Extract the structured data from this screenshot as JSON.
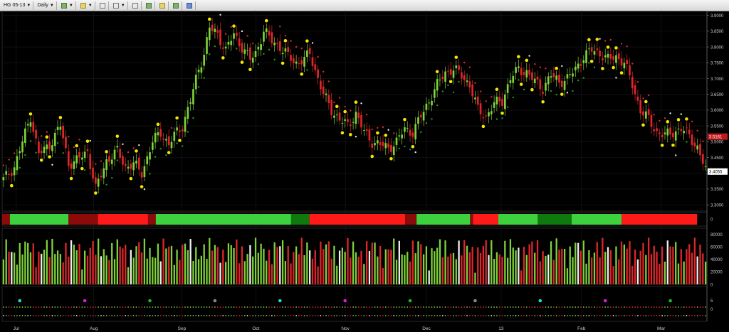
{
  "toolbar": {
    "instrument": "HG 05-13",
    "interval": "Daily"
  },
  "colors": {
    "up": "#7fd23a",
    "down": "#e0262a",
    "background": "#000000",
    "sar_up": "#1aa01a",
    "sar_down": "#e0262a",
    "sar_neutral": "#e8e8e8",
    "swing": "#f2e600",
    "band_strong_green": "#3dd13d",
    "band_dark_green": "#0e7a0e",
    "band_red": "#ff1a1a",
    "band_dark_red": "#8c0a0a"
  },
  "chart_data": {
    "type": "candlestick",
    "instrument": "HG 05-13",
    "interval": "Daily",
    "x_tick_labels": [
      "Jul",
      "Aug",
      "Sep",
      "Oct",
      "Nov",
      "Dec",
      "13",
      "Feb",
      "Mar"
    ],
    "price_axis": {
      "ticks": [
        "3.9000",
        "3.8500",
        "3.8000",
        "3.7500",
        "3.7000",
        "3.6500",
        "3.6000",
        "3.5500",
        "3.5000",
        "3.4500",
        "3.4000",
        "3.3500",
        "3.3000"
      ],
      "range": [
        3.28,
        3.915
      ]
    },
    "price_labels": {
      "marker_1": "3.5161",
      "marker_2": "3.4055"
    },
    "volume_axis": {
      "ticks": [
        "80000",
        "60000",
        "40000",
        "20000",
        "0"
      ],
      "range": [
        0,
        90000
      ]
    },
    "band_axis": {
      "ticks": [
        "0"
      ]
    },
    "dots_axis": {
      "ticks": [
        "5",
        "0"
      ]
    },
    "trend_band": [
      {
        "from": 0.0,
        "to": 0.011,
        "state": "dark_red"
      },
      {
        "from": 0.011,
        "to": 0.094,
        "state": "strong_green"
      },
      {
        "from": 0.094,
        "to": 0.136,
        "state": "dark_red"
      },
      {
        "from": 0.136,
        "to": 0.207,
        "state": "red"
      },
      {
        "from": 0.207,
        "to": 0.218,
        "state": "dark_red"
      },
      {
        "from": 0.218,
        "to": 0.41,
        "state": "strong_green"
      },
      {
        "from": 0.41,
        "to": 0.436,
        "state": "dark_green"
      },
      {
        "from": 0.436,
        "to": 0.572,
        "state": "red"
      },
      {
        "from": 0.572,
        "to": 0.588,
        "state": "dark_red"
      },
      {
        "from": 0.588,
        "to": 0.664,
        "state": "strong_green"
      },
      {
        "from": 0.664,
        "to": 0.668,
        "state": "dark_red"
      },
      {
        "from": 0.668,
        "to": 0.704,
        "state": "red"
      },
      {
        "from": 0.704,
        "to": 0.76,
        "state": "strong_green"
      },
      {
        "from": 0.76,
        "to": 0.808,
        "state": "dark_green"
      },
      {
        "from": 0.808,
        "to": 0.879,
        "state": "strong_green"
      },
      {
        "from": 0.879,
        "to": 0.986,
        "state": "red"
      }
    ],
    "anchors": [
      [
        0,
        3.38
      ],
      [
        4,
        3.42
      ],
      [
        7,
        3.5
      ],
      [
        10,
        3.58
      ],
      [
        13,
        3.46
      ],
      [
        17,
        3.49
      ],
      [
        21,
        3.55
      ],
      [
        24,
        3.43
      ],
      [
        27,
        3.44
      ],
      [
        31,
        3.47
      ],
      [
        34,
        3.35
      ],
      [
        38,
        3.44
      ],
      [
        42,
        3.47
      ],
      [
        45,
        3.42
      ],
      [
        48,
        3.43
      ],
      [
        51,
        3.4
      ],
      [
        55,
        3.5
      ],
      [
        58,
        3.53
      ],
      [
        61,
        3.49
      ],
      [
        63,
        3.52
      ],
      [
        66,
        3.55
      ],
      [
        69,
        3.63
      ],
      [
        72,
        3.73
      ],
      [
        74,
        3.78
      ],
      [
        76,
        3.86
      ],
      [
        79,
        3.84
      ],
      [
        82,
        3.79
      ],
      [
        85,
        3.84
      ],
      [
        88,
        3.8
      ],
      [
        91,
        3.76
      ],
      [
        93,
        3.78
      ],
      [
        96,
        3.85
      ],
      [
        99,
        3.82
      ],
      [
        102,
        3.8
      ],
      [
        105,
        3.77
      ],
      [
        108,
        3.75
      ],
      [
        111,
        3.76
      ],
      [
        113,
        3.78
      ],
      [
        116,
        3.7
      ],
      [
        118,
        3.65
      ],
      [
        121,
        3.6
      ],
      [
        124,
        3.57
      ],
      [
        127,
        3.55
      ],
      [
        130,
        3.59
      ],
      [
        133,
        3.53
      ],
      [
        136,
        3.5
      ],
      [
        139,
        3.49
      ],
      [
        142,
        3.48
      ],
      [
        145,
        3.5
      ],
      [
        148,
        3.54
      ],
      [
        151,
        3.53
      ],
      [
        154,
        3.58
      ],
      [
        157,
        3.63
      ],
      [
        160,
        3.68
      ],
      [
        163,
        3.72
      ],
      [
        166,
        3.73
      ],
      [
        169,
        3.71
      ],
      [
        172,
        3.68
      ],
      [
        175,
        3.6
      ],
      [
        178,
        3.58
      ],
      [
        181,
        3.62
      ],
      [
        184,
        3.63
      ],
      [
        187,
        3.7
      ],
      [
        190,
        3.73
      ],
      [
        193,
        3.72
      ],
      [
        196,
        3.69
      ],
      [
        199,
        3.67
      ],
      [
        202,
        3.71
      ],
      [
        205,
        3.69
      ],
      [
        208,
        3.7
      ],
      [
        211,
        3.73
      ],
      [
        214,
        3.77
      ],
      [
        217,
        3.79
      ],
      [
        220,
        3.78
      ],
      [
        223,
        3.76
      ],
      [
        226,
        3.77
      ],
      [
        229,
        3.75
      ],
      [
        232,
        3.68
      ],
      [
        235,
        3.6
      ],
      [
        238,
        3.57
      ],
      [
        241,
        3.53
      ],
      [
        244,
        3.52
      ],
      [
        247,
        3.53
      ],
      [
        250,
        3.54
      ],
      [
        253,
        3.52
      ],
      [
        256,
        3.48
      ],
      [
        259,
        3.41
      ]
    ]
  }
}
